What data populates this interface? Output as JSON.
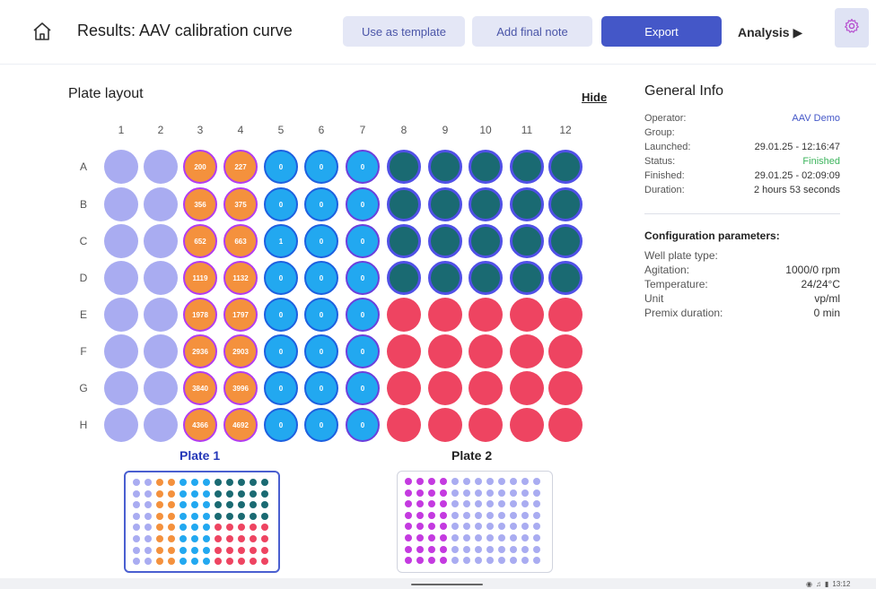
{
  "header": {
    "title": "Results: AAV  calibration curve",
    "buttons": {
      "use_template": "Use as template",
      "add_note": "Add final note",
      "export": "Export"
    },
    "analysis_label": "Analysis ▶",
    "icons": [
      "home-icon",
      "gear-icon"
    ]
  },
  "plate_layout": {
    "title": "Plate layout",
    "hide_label": "Hide",
    "columns": [
      "1",
      "2",
      "3",
      "4",
      "5",
      "6",
      "7",
      "8",
      "9",
      "10",
      "11",
      "12"
    ],
    "rows": [
      "A",
      "B",
      "C",
      "D",
      "E",
      "F",
      "G",
      "H"
    ],
    "colors": {
      "empty": "#a9acf1",
      "standard": "#f4913d",
      "standard_border": "#b13cf0",
      "blank": "#22a8f0",
      "teal": "#1a6a72",
      "teal_border": "#5050e6",
      "red": "#ee4461"
    },
    "wells": [
      [
        "",
        "",
        "200",
        "227",
        "0",
        "0",
        "0",
        "",
        "",
        "",
        "",
        ""
      ],
      [
        "",
        "",
        "356",
        "375",
        "0",
        "0",
        "0",
        "",
        "",
        "",
        "",
        ""
      ],
      [
        "",
        "",
        "652",
        "663",
        "1",
        "0",
        "0",
        "",
        "",
        "",
        "",
        ""
      ],
      [
        "",
        "",
        "1119",
        "1132",
        "0",
        "0",
        "0",
        "",
        "",
        "",
        "",
        ""
      ],
      [
        "",
        "",
        "1978",
        "1797",
        "0",
        "0",
        "0",
        "",
        "",
        "",
        "",
        ""
      ],
      [
        "",
        "",
        "2936",
        "2903",
        "0",
        "0",
        "0",
        "",
        "",
        "",
        "",
        ""
      ],
      [
        "",
        "",
        "3840",
        "3996",
        "0",
        "0",
        "0",
        "",
        "",
        "",
        "",
        ""
      ],
      [
        "",
        "",
        "4366",
        "4692",
        "0",
        "0",
        "0",
        "",
        "",
        "",
        "",
        ""
      ]
    ],
    "well_types": [
      [
        "empty",
        "empty",
        "std",
        "std",
        "zero",
        "zero",
        "zero7",
        "teal",
        "teal",
        "teal",
        "teal",
        "teal"
      ],
      [
        "empty",
        "empty",
        "std",
        "std",
        "zero",
        "zero",
        "zero7",
        "teal",
        "teal",
        "teal",
        "teal",
        "teal"
      ],
      [
        "empty",
        "empty",
        "std",
        "std",
        "zero",
        "zero",
        "zero7",
        "teal",
        "teal",
        "teal",
        "teal",
        "teal"
      ],
      [
        "empty",
        "empty",
        "std",
        "std",
        "zero",
        "zero",
        "zero7",
        "teal",
        "teal",
        "teal",
        "teal",
        "teal"
      ],
      [
        "empty",
        "empty",
        "std",
        "std",
        "zero",
        "zero",
        "zero7",
        "red",
        "red",
        "red",
        "red",
        "red"
      ],
      [
        "empty",
        "empty",
        "std",
        "std",
        "zero",
        "zero",
        "zero7",
        "red",
        "red",
        "red",
        "red",
        "red"
      ],
      [
        "empty",
        "empty",
        "std",
        "std",
        "zero",
        "zero",
        "zero7",
        "red",
        "red",
        "red",
        "red",
        "red"
      ],
      [
        "empty",
        "empty",
        "std",
        "std",
        "zero",
        "zero",
        "zero7",
        "red",
        "red",
        "red",
        "red",
        "red"
      ]
    ]
  },
  "plates": [
    {
      "name": "Plate 1",
      "selected": true,
      "name_color": "#2437b8"
    },
    {
      "name": "Plate 2",
      "selected": false,
      "name_color": "#222222"
    }
  ],
  "plate2_colors": {
    "magenta": "#c43ae0",
    "lavender": "#a9acf1"
  },
  "general_info": {
    "title": "General Info",
    "fields": [
      {
        "label": "Operator:",
        "value": "AAV Demo",
        "color": "#4457c8"
      },
      {
        "label": "Group:",
        "value": ""
      },
      {
        "label": "Launched:",
        "value": "29.01.25 - 12:16:47"
      },
      {
        "label": "Status:",
        "value": "Finished",
        "color": "#3cb45c"
      },
      {
        "label": "Finished:",
        "value": "29.01.25 - 02:09:09"
      },
      {
        "label": "Duration:",
        "value": "2 hours  53 seconds"
      }
    ],
    "config_title": "Configuration parameters:",
    "config": [
      {
        "label": "Well plate type:",
        "value": ""
      },
      {
        "label": "Agitation:",
        "value": "1000/0 rpm"
      },
      {
        "label": "Temperature:",
        "value": "24/24°C"
      },
      {
        "label": "Unit",
        "value": "vp/ml"
      },
      {
        "label": "Premix duration:",
        "value": "0 min"
      }
    ]
  },
  "system_tray": {
    "time": "13:12"
  }
}
